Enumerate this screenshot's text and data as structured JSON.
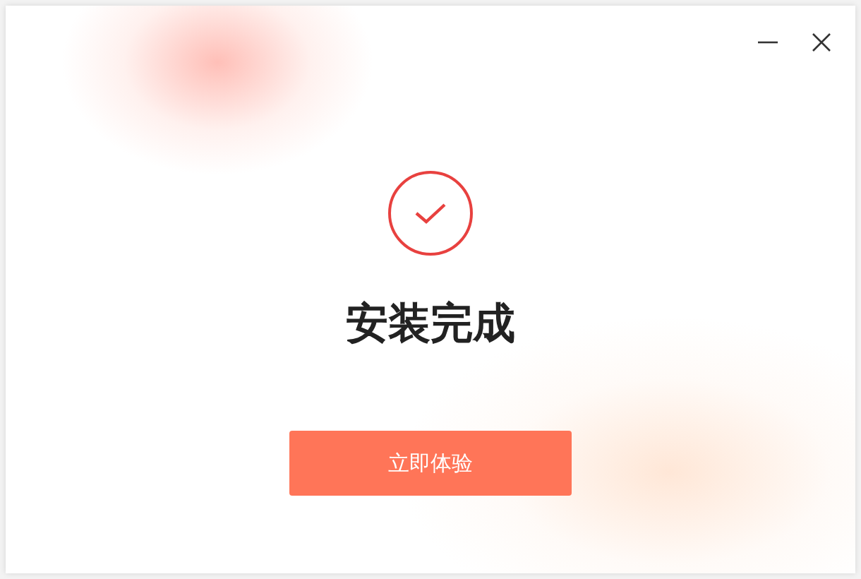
{
  "heading": "安装完成",
  "button": {
    "label": "立即体验"
  }
}
